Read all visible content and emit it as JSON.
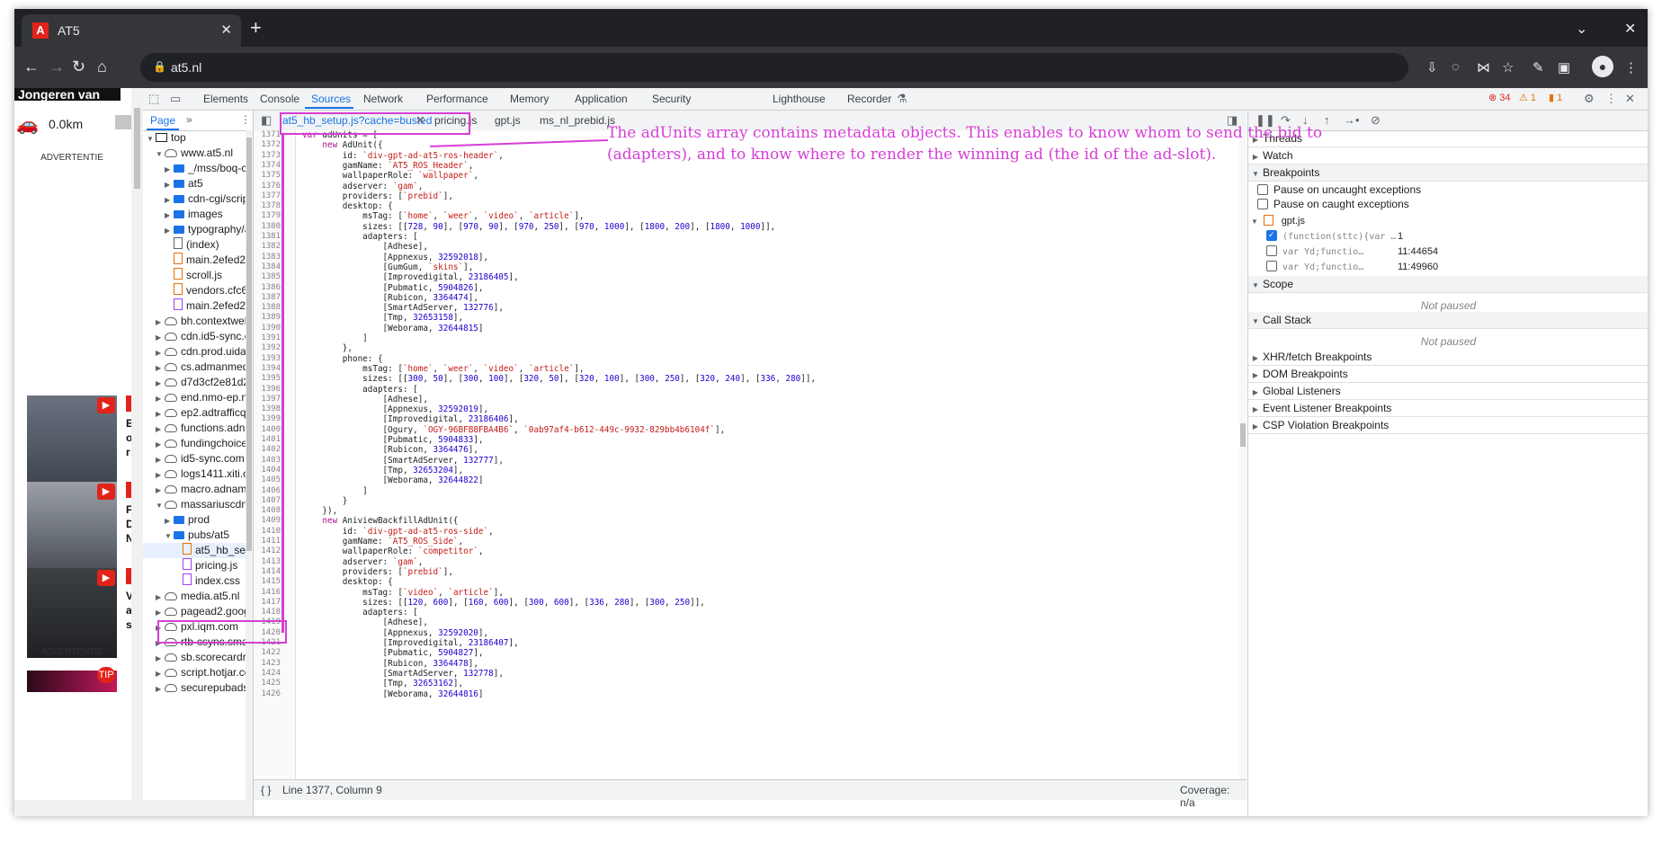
{
  "browser": {
    "tab_title": "AT5",
    "url": "at5.nl"
  },
  "page_preview": {
    "hero": "Jongeren van",
    "distance": "0.0km",
    "advertentie_top": "ADVERTENTIE",
    "advertentie_bottom": "ADVERTENTIE",
    "thumb_letters": [
      "E",
      "o",
      "r",
      "F",
      "D",
      "N",
      "V",
      "a",
      "s"
    ],
    "tip": "TIP"
  },
  "devtools": {
    "tabs": [
      "Elements",
      "Console",
      "Sources",
      "Network",
      "Performance",
      "Memory",
      "Application",
      "Security",
      "Lighthouse",
      "Recorder"
    ],
    "active_tab": "Sources",
    "errors": "34",
    "warnings": "1",
    "issues": "1",
    "navigator": {
      "tab": "Page",
      "more": "»",
      "tree": [
        {
          "label": "top",
          "icon": "frame",
          "indent": 0,
          "arrow": "down"
        },
        {
          "label": "www.at5.nl",
          "icon": "cloud",
          "indent": 1,
          "arrow": "down"
        },
        {
          "label": "_/mss/boq-co",
          "icon": "folder",
          "indent": 2,
          "arrow": "right"
        },
        {
          "label": "at5",
          "icon": "folder",
          "indent": 2,
          "arrow": "right"
        },
        {
          "label": "cdn-cgi/scrip",
          "icon": "folder",
          "indent": 2,
          "arrow": "right"
        },
        {
          "label": "images",
          "icon": "folder",
          "indent": 2,
          "arrow": "right"
        },
        {
          "label": "typography/a",
          "icon": "folder",
          "indent": 2,
          "arrow": "right"
        },
        {
          "label": "(index)",
          "icon": "doc",
          "indent": 2,
          "arrow": ""
        },
        {
          "label": "main.2efed2e",
          "icon": "js",
          "indent": 2,
          "arrow": ""
        },
        {
          "label": "scroll.js",
          "icon": "js",
          "indent": 2,
          "arrow": ""
        },
        {
          "label": "vendors.cfc6",
          "icon": "js",
          "indent": 2,
          "arrow": ""
        },
        {
          "label": "main.2efed2e",
          "icon": "css",
          "indent": 2,
          "arrow": ""
        },
        {
          "label": "bh.contextweb.",
          "icon": "cloud",
          "indent": 1,
          "arrow": "right"
        },
        {
          "label": "cdn.id5-sync.co",
          "icon": "cloud",
          "indent": 1,
          "arrow": "right"
        },
        {
          "label": "cdn.prod.uidap",
          "icon": "cloud",
          "indent": 1,
          "arrow": "right"
        },
        {
          "label": "cs.admanmedia",
          "icon": "cloud",
          "indent": 1,
          "arrow": "right"
        },
        {
          "label": "d7d3cf2e81d29",
          "icon": "cloud",
          "indent": 1,
          "arrow": "right"
        },
        {
          "label": "end.nmo-ep.nl",
          "icon": "cloud",
          "indent": 1,
          "arrow": "right"
        },
        {
          "label": "ep2.adtrafficqu",
          "icon": "cloud",
          "indent": 1,
          "arrow": "right"
        },
        {
          "label": "functions.adnar",
          "icon": "cloud",
          "indent": 1,
          "arrow": "right"
        },
        {
          "label": "fundingchoices",
          "icon": "cloud",
          "indent": 1,
          "arrow": "right"
        },
        {
          "label": "id5-sync.com",
          "icon": "cloud",
          "indent": 1,
          "arrow": "right"
        },
        {
          "label": "logs1411.xiti.cc",
          "icon": "cloud",
          "indent": 1,
          "arrow": "right"
        },
        {
          "label": "macro.adnami.",
          "icon": "cloud",
          "indent": 1,
          "arrow": "right"
        },
        {
          "label": "massariuscdn.c",
          "icon": "cloud",
          "indent": 1,
          "arrow": "down"
        },
        {
          "label": "prod",
          "icon": "folder",
          "indent": 2,
          "arrow": "right"
        },
        {
          "label": "pubs/at5",
          "icon": "folder",
          "indent": 2,
          "arrow": "down"
        },
        {
          "label": "at5_hb_se",
          "icon": "js",
          "indent": 3,
          "arrow": ""
        },
        {
          "label": "pricing.js",
          "icon": "css",
          "indent": 3,
          "arrow": ""
        },
        {
          "label": "index.css",
          "icon": "css",
          "indent": 3,
          "arrow": ""
        },
        {
          "label": "media.at5.nl",
          "icon": "cloud",
          "indent": 1,
          "arrow": "right"
        },
        {
          "label": "pagead2.googl",
          "icon": "cloud",
          "indent": 1,
          "arrow": "right"
        },
        {
          "label": "pxl.iqm.com",
          "icon": "cloud",
          "indent": 1,
          "arrow": "right"
        },
        {
          "label": "rtb-csync.smar",
          "icon": "cloud",
          "indent": 1,
          "arrow": "right"
        },
        {
          "label": "sb.scorecardre",
          "icon": "cloud",
          "indent": 1,
          "arrow": "right"
        },
        {
          "label": "script.hotjar.cor",
          "icon": "cloud",
          "indent": 1,
          "arrow": "right"
        },
        {
          "label": "securepubads.c",
          "icon": "cloud",
          "indent": 1,
          "arrow": "right"
        }
      ]
    },
    "editor": {
      "file_tabs": [
        "at5_hb_setup.js?cache=busted",
        "pricing.js",
        "gpt.js",
        "ms_nl_prebid.js"
      ],
      "status_position": "Line 1377, Column 9",
      "coverage": "Coverage: n/a",
      "first_line_number": 1371,
      "lines": [
        "var adUnits = [",
        "    new AdUnit({",
        "        id: `div-gpt-ad-at5-ros-header`,",
        "        gamName: `AT5_ROS_Header`,",
        "        wallpaperRole: `wallpaper`,",
        "        adserver: `gam`,",
        "        providers: [`prebid`],",
        "        desktop: {",
        "            msTag: [`home`, `weer`, `video`, `article`],",
        "            sizes: [[728, 90], [970, 90], [970, 250], [970, 1000], [1800, 200], [1800, 1000]],",
        "            adapters: [",
        "                [Adhese],",
        "                [Appnexus, 32592018],",
        "                [GumGum, `skins`],",
        "                [Improvedigital, 23186405],",
        "                [Pubmatic, 5904826],",
        "                [Rubicon, 3364474],",
        "                [SmartAdServer, 132776],",
        "                [Tmp, 32653158],",
        "                [Weborama, 32644815]",
        "            ]",
        "        },",
        "        phone: {",
        "            msTag: [`home`, `weer`, `video`, `article`],",
        "            sizes: [[300, 50], [300, 100], [320, 50], [320, 100], [300, 250], [320, 240], [336, 280]],",
        "            adapters: [",
        "                [Adhese],",
        "                [Appnexus, 32592019],",
        "                [Improvedigital, 23186406],",
        "                [Ogury, `OGY-96BFB8FBA4B6`, `0ab97af4-b612-449c-9932-829bb4b6104f`],",
        "                [Pubmatic, 5904833],",
        "                [Rubicon, 3364476],",
        "                [SmartAdServer, 132777],",
        "                [Tmp, 32653204],",
        "                [Weborama, 32644822]",
        "            ]",
        "        }",
        "    }),",
        "    new AniviewBackfillAdUnit({",
        "        id: `div-gpt-ad-at5-ros-side`,",
        "        gamName: `AT5_ROS_Side`,",
        "        wallpaperRole: `competitor`,",
        "        adserver: `gam`,",
        "        providers: [`prebid`],",
        "        desktop: {",
        "            msTag: [`video`, `article`],",
        "            sizes: [[120, 600], [160, 600], [300, 600], [336, 280], [300, 250]],",
        "            adapters: [",
        "                [Adhese],",
        "                [Appnexus, 32592020],",
        "                [Improvedigital, 23186407],",
        "                [Pubmatic, 5904827],",
        "                [Rubicon, 3364478],",
        "                [SmartAdServer, 132778],",
        "                [Tmp, 32653162],",
        "                [Weborama, 32644816]"
      ]
    },
    "debugger": {
      "threads": "Threads",
      "watch": "Watch",
      "breakpoints": "Breakpoints",
      "pause_uncaught": "Pause on uncaught exceptions",
      "pause_caught": "Pause on caught exceptions",
      "bp_file": "gpt.js",
      "bp_rows": [
        {
          "code": "(function(sttc){var …",
          "loc": "1",
          "checked": true
        },
        {
          "code": "var Yd;functio…",
          "loc": "11:44654",
          "checked": false
        },
        {
          "code": "var Yd;functio…",
          "loc": "11:49960",
          "checked": false
        }
      ],
      "scope": "Scope",
      "scope_state": "Not paused",
      "call_stack": "Call Stack",
      "call_stack_state": "Not paused",
      "collapsed_sections": [
        "XHR/fetch Breakpoints",
        "DOM Breakpoints",
        "Global Listeners",
        "Event Listener Breakpoints",
        "CSP Violation Breakpoints"
      ]
    }
  },
  "annotation": {
    "text": "The adUnits array contains metadata objects. This enables to know whom to send the bid to (adapters), and to know where to render the winning ad (the id of the ad-slot)."
  },
  "colors": {
    "annotation": "#d63ed6",
    "accent": "#1a73e8",
    "keyword": "#aa0d91",
    "string": "#c41a16",
    "number": "#1c00cf"
  }
}
